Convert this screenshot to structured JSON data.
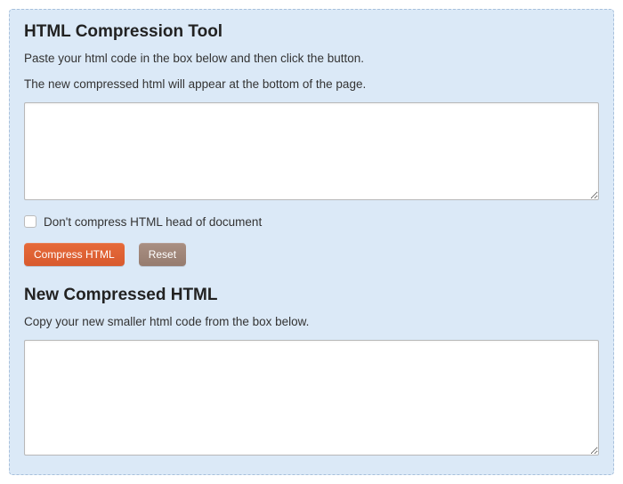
{
  "title": "HTML Compression Tool",
  "intro1": "Paste your html code in the box below and then click the button.",
  "intro2": "The new compressed html will appear at the bottom of the page.",
  "input_value": "",
  "checkbox_label": "Don't compress HTML head of document",
  "buttons": {
    "compress": "Compress HTML",
    "reset": "Reset"
  },
  "output_title": "New Compressed HTML",
  "output_intro": "Copy your new smaller html code from the box below.",
  "output_value": ""
}
